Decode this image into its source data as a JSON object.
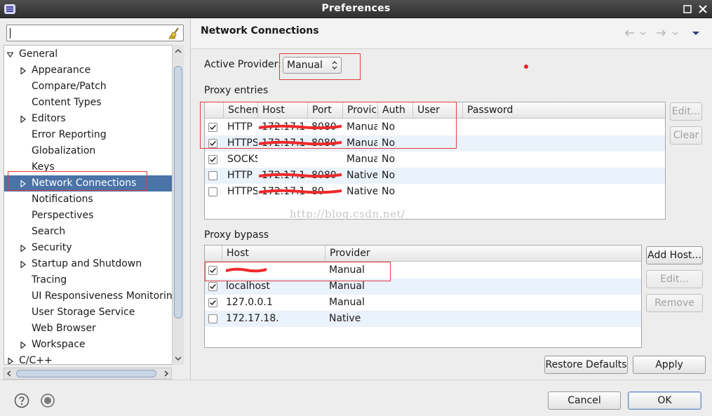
{
  "window": {
    "title": "Preferences"
  },
  "filter": {
    "value": "",
    "placeholder": ""
  },
  "tree": {
    "items": [
      {
        "label": "General",
        "level": 0,
        "arrow": "expanded"
      },
      {
        "label": "Appearance",
        "level": 1,
        "arrow": "collapsed"
      },
      {
        "label": "Compare/Patch",
        "level": 1,
        "arrow": "none"
      },
      {
        "label": "Content Types",
        "level": 1,
        "arrow": "none"
      },
      {
        "label": "Editors",
        "level": 1,
        "arrow": "collapsed"
      },
      {
        "label": "Error Reporting",
        "level": 1,
        "arrow": "none"
      },
      {
        "label": "Globalization",
        "level": 1,
        "arrow": "none"
      },
      {
        "label": "Keys",
        "level": 1,
        "arrow": "none"
      },
      {
        "label": "Network Connections",
        "level": 1,
        "arrow": "collapsed",
        "selected": true
      },
      {
        "label": "Notifications",
        "level": 1,
        "arrow": "none"
      },
      {
        "label": "Perspectives",
        "level": 1,
        "arrow": "none"
      },
      {
        "label": "Search",
        "level": 1,
        "arrow": "none"
      },
      {
        "label": "Security",
        "level": 1,
        "arrow": "collapsed"
      },
      {
        "label": "Startup and Shutdown",
        "level": 1,
        "arrow": "collapsed"
      },
      {
        "label": "Tracing",
        "level": 1,
        "arrow": "none"
      },
      {
        "label": "UI Responsiveness Monitoring",
        "level": 1,
        "arrow": "none"
      },
      {
        "label": "User Storage Service",
        "level": 1,
        "arrow": "none"
      },
      {
        "label": "Web Browser",
        "level": 1,
        "arrow": "none"
      },
      {
        "label": "Workspace",
        "level": 1,
        "arrow": "collapsed"
      },
      {
        "label": "C/C++",
        "level": 0,
        "arrow": "collapsed"
      }
    ]
  },
  "page": {
    "title": "Network Connections",
    "active_provider_label": "Active Provider:",
    "active_provider_value": "Manual",
    "proxy_entries_label": "Proxy entries",
    "proxy_bypass_label": "Proxy bypass"
  },
  "proxy_entries": {
    "columns": [
      "Schem",
      "Host",
      "Port",
      "Provic",
      "Auth",
      "User",
      "Password"
    ],
    "rows": [
      {
        "checked": true,
        "scheme": "HTTP",
        "host": "172.17.1",
        "port": "8080",
        "provider": "Manual",
        "auth": "No",
        "user": "",
        "password": ""
      },
      {
        "checked": true,
        "scheme": "HTTPS",
        "host": "172.17.1",
        "port": "8080",
        "provider": "Manual",
        "auth": "No",
        "user": "",
        "password": ""
      },
      {
        "checked": true,
        "scheme": "SOCKS",
        "host": "",
        "port": "",
        "provider": "Manual",
        "auth": "No",
        "user": "",
        "password": ""
      },
      {
        "checked": false,
        "scheme": "HTTP",
        "host": "172.17.1",
        "port": "8080",
        "provider": "Native",
        "auth": "No",
        "user": "",
        "password": ""
      },
      {
        "checked": false,
        "scheme": "HTTPS",
        "host": "172.17.1",
        "port": "80",
        "provider": "Native",
        "auth": "No",
        "user": "",
        "password": ""
      }
    ],
    "buttons": {
      "edit": "Edit...",
      "clear": "Clear"
    }
  },
  "proxy_bypass": {
    "columns": [
      "Host",
      "Provider"
    ],
    "rows": [
      {
        "checked": true,
        "host": "",
        "provider": "Manual"
      },
      {
        "checked": true,
        "host": "localhost",
        "provider": "Manual"
      },
      {
        "checked": true,
        "host": "127.0.0.1",
        "provider": "Manual"
      },
      {
        "checked": false,
        "host": "172.17.18.",
        "provider": "Native"
      }
    ],
    "buttons": {
      "add_host": "Add Host...",
      "edit": "Edit...",
      "remove": "Remove"
    }
  },
  "actions": {
    "restore_defaults": "Restore Defaults",
    "apply": "Apply",
    "cancel": "Cancel",
    "ok": "OK"
  },
  "watermark": "http://blog.csdn.net/"
}
